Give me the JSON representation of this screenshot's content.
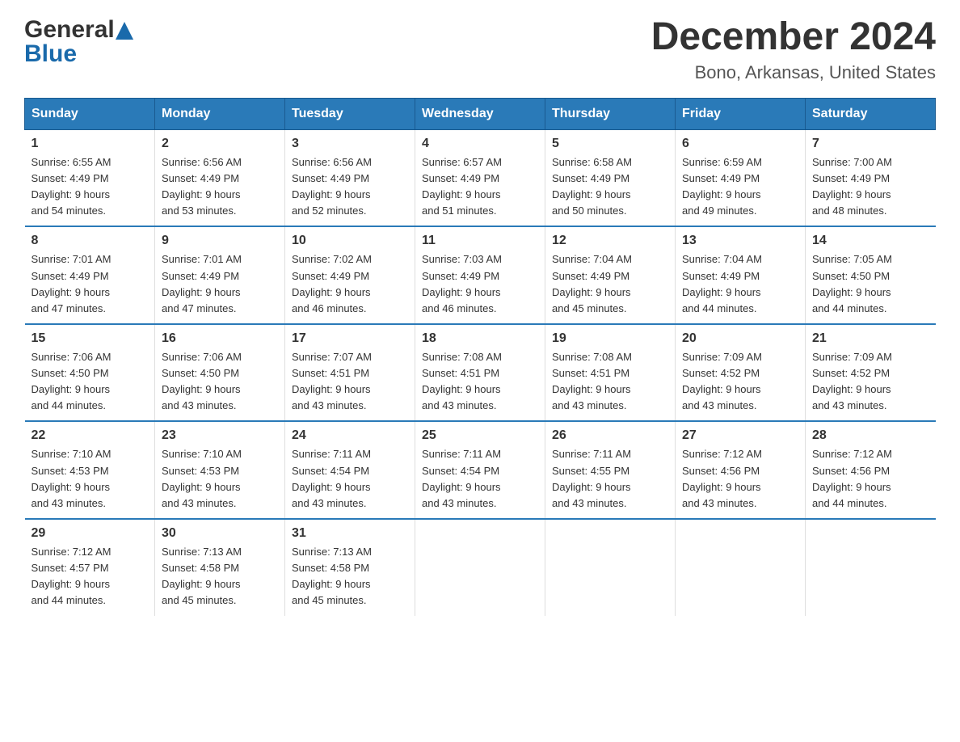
{
  "header": {
    "title": "December 2024",
    "subtitle": "Bono, Arkansas, United States"
  },
  "days_of_week": [
    "Sunday",
    "Monday",
    "Tuesday",
    "Wednesday",
    "Thursday",
    "Friday",
    "Saturday"
  ],
  "weeks": [
    [
      {
        "day": "1",
        "sunrise": "6:55 AM",
        "sunset": "4:49 PM",
        "daylight": "9 hours and 54 minutes."
      },
      {
        "day": "2",
        "sunrise": "6:56 AM",
        "sunset": "4:49 PM",
        "daylight": "9 hours and 53 minutes."
      },
      {
        "day": "3",
        "sunrise": "6:56 AM",
        "sunset": "4:49 PM",
        "daylight": "9 hours and 52 minutes."
      },
      {
        "day": "4",
        "sunrise": "6:57 AM",
        "sunset": "4:49 PM",
        "daylight": "9 hours and 51 minutes."
      },
      {
        "day": "5",
        "sunrise": "6:58 AM",
        "sunset": "4:49 PM",
        "daylight": "9 hours and 50 minutes."
      },
      {
        "day": "6",
        "sunrise": "6:59 AM",
        "sunset": "4:49 PM",
        "daylight": "9 hours and 49 minutes."
      },
      {
        "day": "7",
        "sunrise": "7:00 AM",
        "sunset": "4:49 PM",
        "daylight": "9 hours and 48 minutes."
      }
    ],
    [
      {
        "day": "8",
        "sunrise": "7:01 AM",
        "sunset": "4:49 PM",
        "daylight": "9 hours and 47 minutes."
      },
      {
        "day": "9",
        "sunrise": "7:01 AM",
        "sunset": "4:49 PM",
        "daylight": "9 hours and 47 minutes."
      },
      {
        "day": "10",
        "sunrise": "7:02 AM",
        "sunset": "4:49 PM",
        "daylight": "9 hours and 46 minutes."
      },
      {
        "day": "11",
        "sunrise": "7:03 AM",
        "sunset": "4:49 PM",
        "daylight": "9 hours and 46 minutes."
      },
      {
        "day": "12",
        "sunrise": "7:04 AM",
        "sunset": "4:49 PM",
        "daylight": "9 hours and 45 minutes."
      },
      {
        "day": "13",
        "sunrise": "7:04 AM",
        "sunset": "4:49 PM",
        "daylight": "9 hours and 44 minutes."
      },
      {
        "day": "14",
        "sunrise": "7:05 AM",
        "sunset": "4:50 PM",
        "daylight": "9 hours and 44 minutes."
      }
    ],
    [
      {
        "day": "15",
        "sunrise": "7:06 AM",
        "sunset": "4:50 PM",
        "daylight": "9 hours and 44 minutes."
      },
      {
        "day": "16",
        "sunrise": "7:06 AM",
        "sunset": "4:50 PM",
        "daylight": "9 hours and 43 minutes."
      },
      {
        "day": "17",
        "sunrise": "7:07 AM",
        "sunset": "4:51 PM",
        "daylight": "9 hours and 43 minutes."
      },
      {
        "day": "18",
        "sunrise": "7:08 AM",
        "sunset": "4:51 PM",
        "daylight": "9 hours and 43 minutes."
      },
      {
        "day": "19",
        "sunrise": "7:08 AM",
        "sunset": "4:51 PM",
        "daylight": "9 hours and 43 minutes."
      },
      {
        "day": "20",
        "sunrise": "7:09 AM",
        "sunset": "4:52 PM",
        "daylight": "9 hours and 43 minutes."
      },
      {
        "day": "21",
        "sunrise": "7:09 AM",
        "sunset": "4:52 PM",
        "daylight": "9 hours and 43 minutes."
      }
    ],
    [
      {
        "day": "22",
        "sunrise": "7:10 AM",
        "sunset": "4:53 PM",
        "daylight": "9 hours and 43 minutes."
      },
      {
        "day": "23",
        "sunrise": "7:10 AM",
        "sunset": "4:53 PM",
        "daylight": "9 hours and 43 minutes."
      },
      {
        "day": "24",
        "sunrise": "7:11 AM",
        "sunset": "4:54 PM",
        "daylight": "9 hours and 43 minutes."
      },
      {
        "day": "25",
        "sunrise": "7:11 AM",
        "sunset": "4:54 PM",
        "daylight": "9 hours and 43 minutes."
      },
      {
        "day": "26",
        "sunrise": "7:11 AM",
        "sunset": "4:55 PM",
        "daylight": "9 hours and 43 minutes."
      },
      {
        "day": "27",
        "sunrise": "7:12 AM",
        "sunset": "4:56 PM",
        "daylight": "9 hours and 43 minutes."
      },
      {
        "day": "28",
        "sunrise": "7:12 AM",
        "sunset": "4:56 PM",
        "daylight": "9 hours and 44 minutes."
      }
    ],
    [
      {
        "day": "29",
        "sunrise": "7:12 AM",
        "sunset": "4:57 PM",
        "daylight": "9 hours and 44 minutes."
      },
      {
        "day": "30",
        "sunrise": "7:13 AM",
        "sunset": "4:58 PM",
        "daylight": "9 hours and 45 minutes."
      },
      {
        "day": "31",
        "sunrise": "7:13 AM",
        "sunset": "4:58 PM",
        "daylight": "9 hours and 45 minutes."
      },
      null,
      null,
      null,
      null
    ]
  ],
  "labels": {
    "sunrise": "Sunrise:",
    "sunset": "Sunset:",
    "daylight": "Daylight:"
  }
}
